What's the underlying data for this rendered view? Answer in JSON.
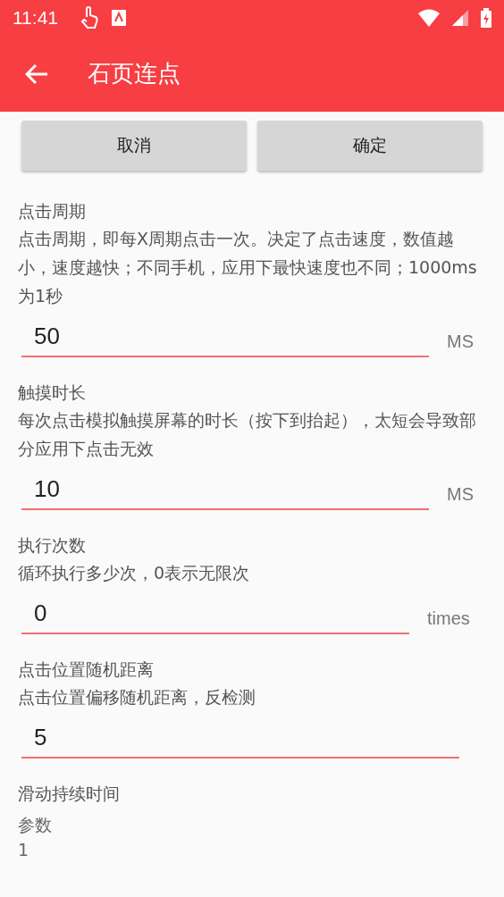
{
  "status_bar": {
    "time": "11:41"
  },
  "app_bar": {
    "title": "石页连点"
  },
  "buttons": [
    {
      "label": "取消"
    },
    {
      "label": "确定"
    }
  ],
  "settings": [
    {
      "kind": "input",
      "title": "点击周期",
      "description": "点击周期，即每X周期点击一次。决定了点击速度，数值越小，速度越快；不同手机，应用下最快速度也不同；1000ms为1秒",
      "value": "50",
      "unit": "MS"
    },
    {
      "kind": "input",
      "title": "触摸时长",
      "description": "每次点击模拟触摸屏幕的时长（按下到抬起），太短会导致部分应用下点击无效",
      "value": "10",
      "unit": "MS"
    },
    {
      "kind": "input",
      "title": "执行次数",
      "description": "循环执行多少次，0表示无限次",
      "value": "0",
      "unit": "times"
    },
    {
      "kind": "input",
      "title": "点击位置随机距离",
      "description": "点击位置偏移随机距离，反检测",
      "value": "5"
    },
    {
      "kind": "param",
      "title": "滑动持续时间",
      "label": "参数",
      "value": "1"
    }
  ]
}
